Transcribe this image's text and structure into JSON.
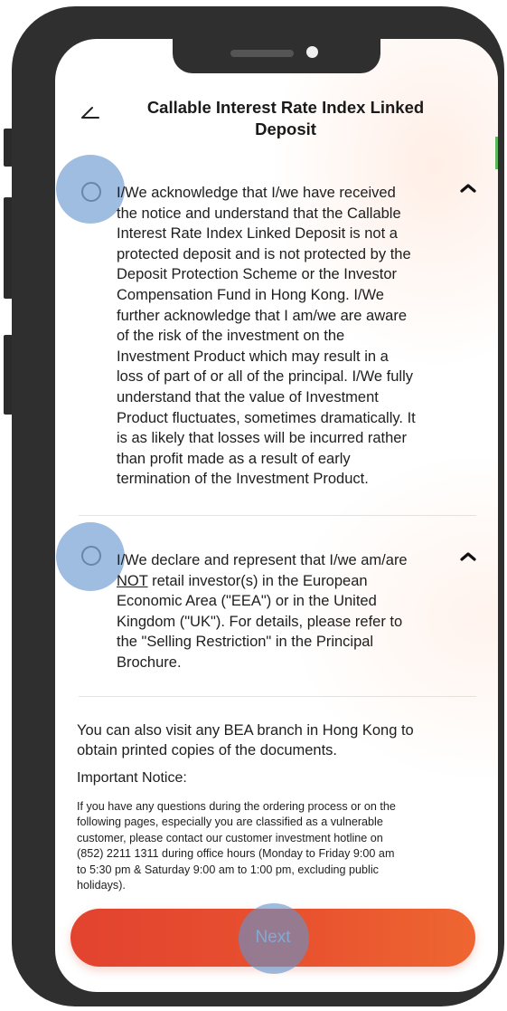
{
  "header": {
    "title_line1": "Callable Interest Rate Index Linked",
    "title_line2": "Deposit"
  },
  "sections": [
    {
      "lines": [
        "I/We acknowledge that I/we have received",
        "the notice and understand that the Callable",
        "Interest Rate Index Linked Deposit is not a",
        "protected deposit and is not protected by the",
        "Deposit Protection Scheme or the Investor",
        "Compensation Fund in Hong Kong. I/We",
        "further acknowledge that I am/we are aware",
        "of the risk of the investment on the",
        "Investment Product which may result in a",
        "loss of part of or all of the principal. I/We fully",
        "understand that the value of Investment",
        "Product fluctuates, sometimes dramatically. It",
        "is as likely that losses will be incurred rather",
        "than profit made as a result of early",
        "termination of the Investment Product."
      ]
    },
    {
      "line1": "I/We declare and represent that I/we am/are",
      "line2_underlined": "NOT",
      "line2_rest": " retail investor(s) in the European",
      "lines_rest": [
        "Economic Area (\"EEA\") or in the United",
        "Kingdom (\"UK\"). For details, please refer to",
        "the \"Selling Restriction\" in the Principal",
        "Brochure."
      ]
    }
  ],
  "info": {
    "visit_line1": "You can also visit any BEA branch in Hong Kong to",
    "visit_line2": "obtain printed copies of the documents.",
    "notice_heading": "Important Notice:",
    "notice_lines": [
      "If you have any questions during the ordering process or on the",
      "following pages, especially you are classified as a vulnerable",
      "customer, please contact our customer investment hotline on",
      "(852) 2211 1311 during office hours (Monday to Friday 9:00 am",
      "to 5:30 pm & Saturday 9:00 am to 1:00 pm, excluding public",
      "holidays)."
    ]
  },
  "footer": {
    "next_label": "Next"
  },
  "colors": {
    "button_start": "#e2432f",
    "button_end": "#ee6631",
    "tap_indicator": "#6494cd"
  }
}
